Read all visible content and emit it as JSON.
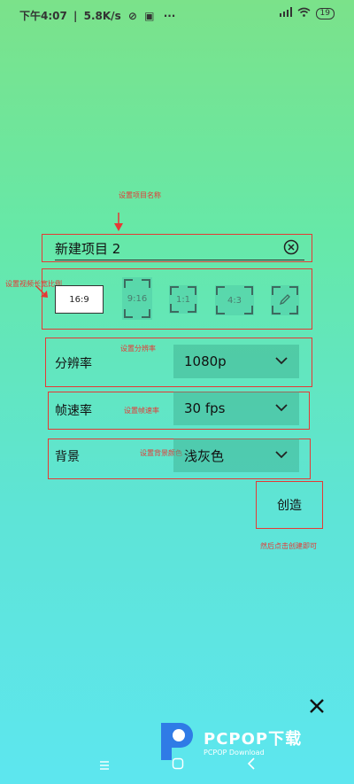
{
  "status": {
    "time": "下午4:07",
    "speed": "5.8K/s",
    "more": "···",
    "network": "HD",
    "battery": "19"
  },
  "annotations": {
    "name": "设置项目名称",
    "ratio": "设置视频长宽比例",
    "resolution": "设置分辨率",
    "framerate": "设置帧速率",
    "background": "设置背景颜色",
    "create": "然后点击创建即可"
  },
  "project": {
    "name": "新建项目 2"
  },
  "ratios": [
    "16:9",
    "9:16",
    "1:1",
    "4:3"
  ],
  "ratio_selected": "16:9",
  "settings": {
    "resolution": {
      "label": "分辨率",
      "value": "1080p"
    },
    "framerate": {
      "label": "帧速率",
      "value": "30 fps"
    },
    "background": {
      "label": "背景",
      "value": "浅灰色"
    }
  },
  "create_label": "创造",
  "watermark": {
    "brand": "PCPOP下载",
    "sub": "PCPOP Download"
  },
  "colors": {
    "annotation": "#e53935",
    "bg_top": "#7be28a",
    "bg_bottom": "#5de6ef"
  }
}
